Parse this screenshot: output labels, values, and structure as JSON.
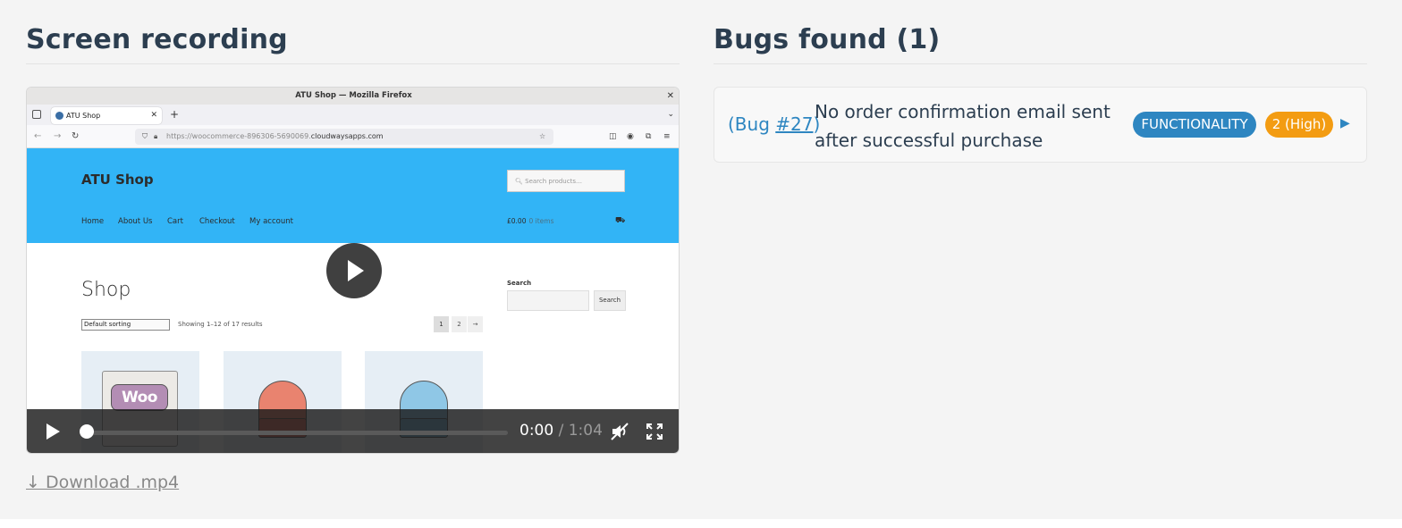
{
  "recording": {
    "heading": "Screen recording",
    "download_label": "↓ Download .mp4",
    "player": {
      "current_time": "0:00",
      "separator": " / ",
      "duration": "1:04",
      "progress_fraction": 0,
      "muted": true
    },
    "frame": {
      "window_title": "ATU Shop — Mozilla Firefox",
      "tab_label": "ATU Shop",
      "url_prefix": "https://woocommerce-896306-5690069.",
      "url_domain": "cloudwaysapps.com",
      "site_title": "ATU Shop",
      "search_placeholder": "Search products…",
      "nav_items": [
        "Home",
        "About Us",
        "Cart",
        "Checkout",
        "My account"
      ],
      "cart_total": "£0.00",
      "cart_items": "0 items",
      "page_heading": "Shop",
      "sorting": "Default sorting",
      "result_count": "Showing 1–12 of 17 results",
      "pages": [
        "1",
        "2",
        "→"
      ],
      "sidebar_search_label": "Search",
      "sidebar_search_button": "Search",
      "woo_logo_text": "Woo",
      "product_colors": [
        "#e9836f",
        "#8fc7e6"
      ]
    }
  },
  "bugs": {
    "heading": "Bugs found (1)",
    "items": [
      {
        "ref_prefix": "(Bug ",
        "ref_number": "#27",
        "ref_suffix": ")",
        "title": "No order confirmation email sent after successful purchase",
        "category": "FUNCTIONALITY",
        "severity": "2 (High)",
        "expand_icon": "▶"
      }
    ]
  },
  "colors": {
    "accent": "#2e86c1",
    "severity_high": "#f39c12",
    "site_header": "#32b4f6"
  }
}
